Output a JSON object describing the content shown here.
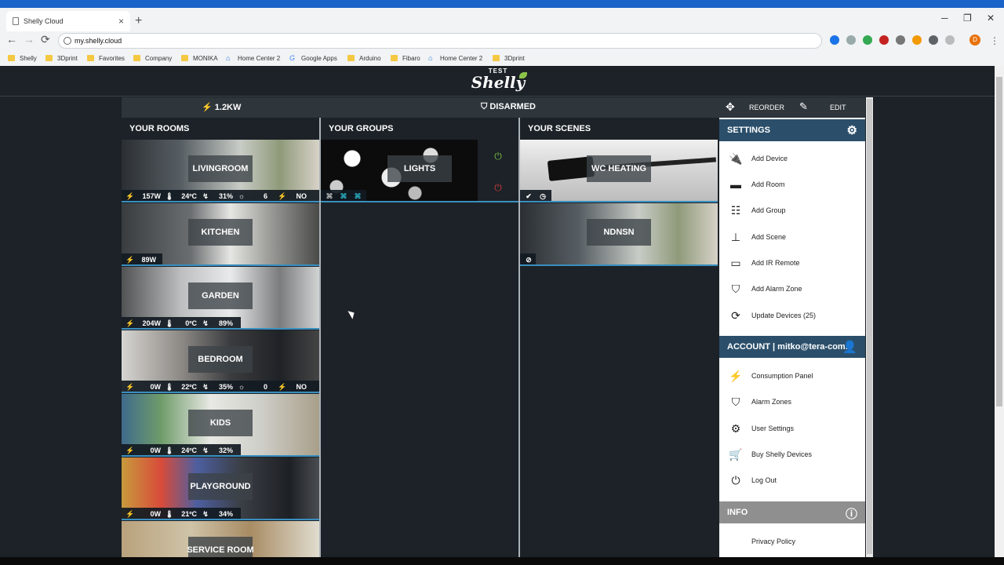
{
  "browser": {
    "tab_title": "Shelly Cloud",
    "tab_close": "×",
    "new_tab": "+",
    "url": "my.shelly.cloud",
    "win_min": "─",
    "win_max": "❐",
    "win_close": "✕",
    "back": "←",
    "forward": "→",
    "reload": "⟳",
    "profile_letter": "D",
    "menu_dots": "⋮",
    "bookmarks": [
      "Shelly",
      "3Dprint",
      "Favorites",
      "Company",
      "MONIKA",
      "Home Center 2",
      "Google Apps",
      "Arduino",
      "Fibaro",
      "Home Center 2",
      "3Dprint"
    ]
  },
  "app": {
    "logo_test": "TEST",
    "logo_brand": "Shelly",
    "power": "1.2KW",
    "alarm": "DISARMED",
    "rooms_header": "YOUR ROOMS",
    "groups_header": "YOUR GROUPS",
    "scenes_header": "YOUR SCENES"
  },
  "rooms": [
    {
      "name": "LIVINGROOM",
      "power": "157W",
      "temp": "24ºC",
      "humidity": "31%",
      "lux": "6",
      "motion": "NO"
    },
    {
      "name": "KITCHEN",
      "power": "89W"
    },
    {
      "name": "GARDEN",
      "power": "204W",
      "temp": "0ºC",
      "humidity": "89%"
    },
    {
      "name": "BEDROOM",
      "power": "0W",
      "temp": "22ºC",
      "humidity": "35%",
      "lux": "0",
      "motion": "NO"
    },
    {
      "name": "KIDS",
      "power": "0W",
      "temp": "24ºC",
      "humidity": "32%"
    },
    {
      "name": "PLAYGROUND",
      "power": "0W",
      "temp": "21ºC",
      "humidity": "34%"
    },
    {
      "name": "SERVICE ROOM"
    }
  ],
  "groups": [
    {
      "name": "LIGHTS"
    }
  ],
  "scenes": [
    {
      "name": "WC HEATING"
    },
    {
      "name": "NDNSN"
    }
  ],
  "panel": {
    "reorder": "REORDER",
    "edit": "EDIT",
    "settings_header": "SETTINGS",
    "settings_items": [
      "Add Device",
      "Add Room",
      "Add Group",
      "Add Scene",
      "Add IR Remote",
      "Add Alarm Zone",
      "Update Devices (25)"
    ],
    "account_header": "ACCOUNT | mitko@tera-com...",
    "account_items": [
      "Consumption Panel",
      "Alarm Zones",
      "User Settings",
      "Buy Shelly Devices",
      "Log Out"
    ],
    "info_header": "INFO",
    "info_items": [
      "Privacy Policy"
    ]
  },
  "colors": {
    "background": "#1c2227",
    "accent": "#2b4f6b",
    "power_on": "#7cc142",
    "power_off": "#d33b3b",
    "group_icon": "#2bb5c8"
  }
}
